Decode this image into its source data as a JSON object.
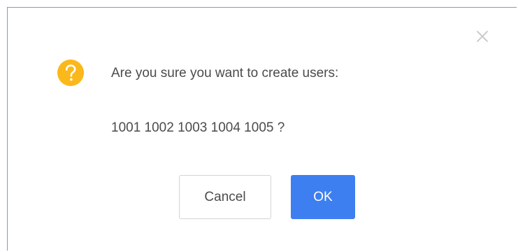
{
  "dialog": {
    "message": "Are you sure you want to create users:",
    "detail": "1001 1002 1003 1004 1005 ?",
    "cancel_label": "Cancel",
    "ok_label": "OK",
    "icon": "question-icon",
    "close_icon": "close-icon"
  },
  "colors": {
    "icon_bg": "#fbb81a",
    "primary": "#3d7ff0",
    "text": "#4b4b4b",
    "close": "#c6c6c6"
  }
}
